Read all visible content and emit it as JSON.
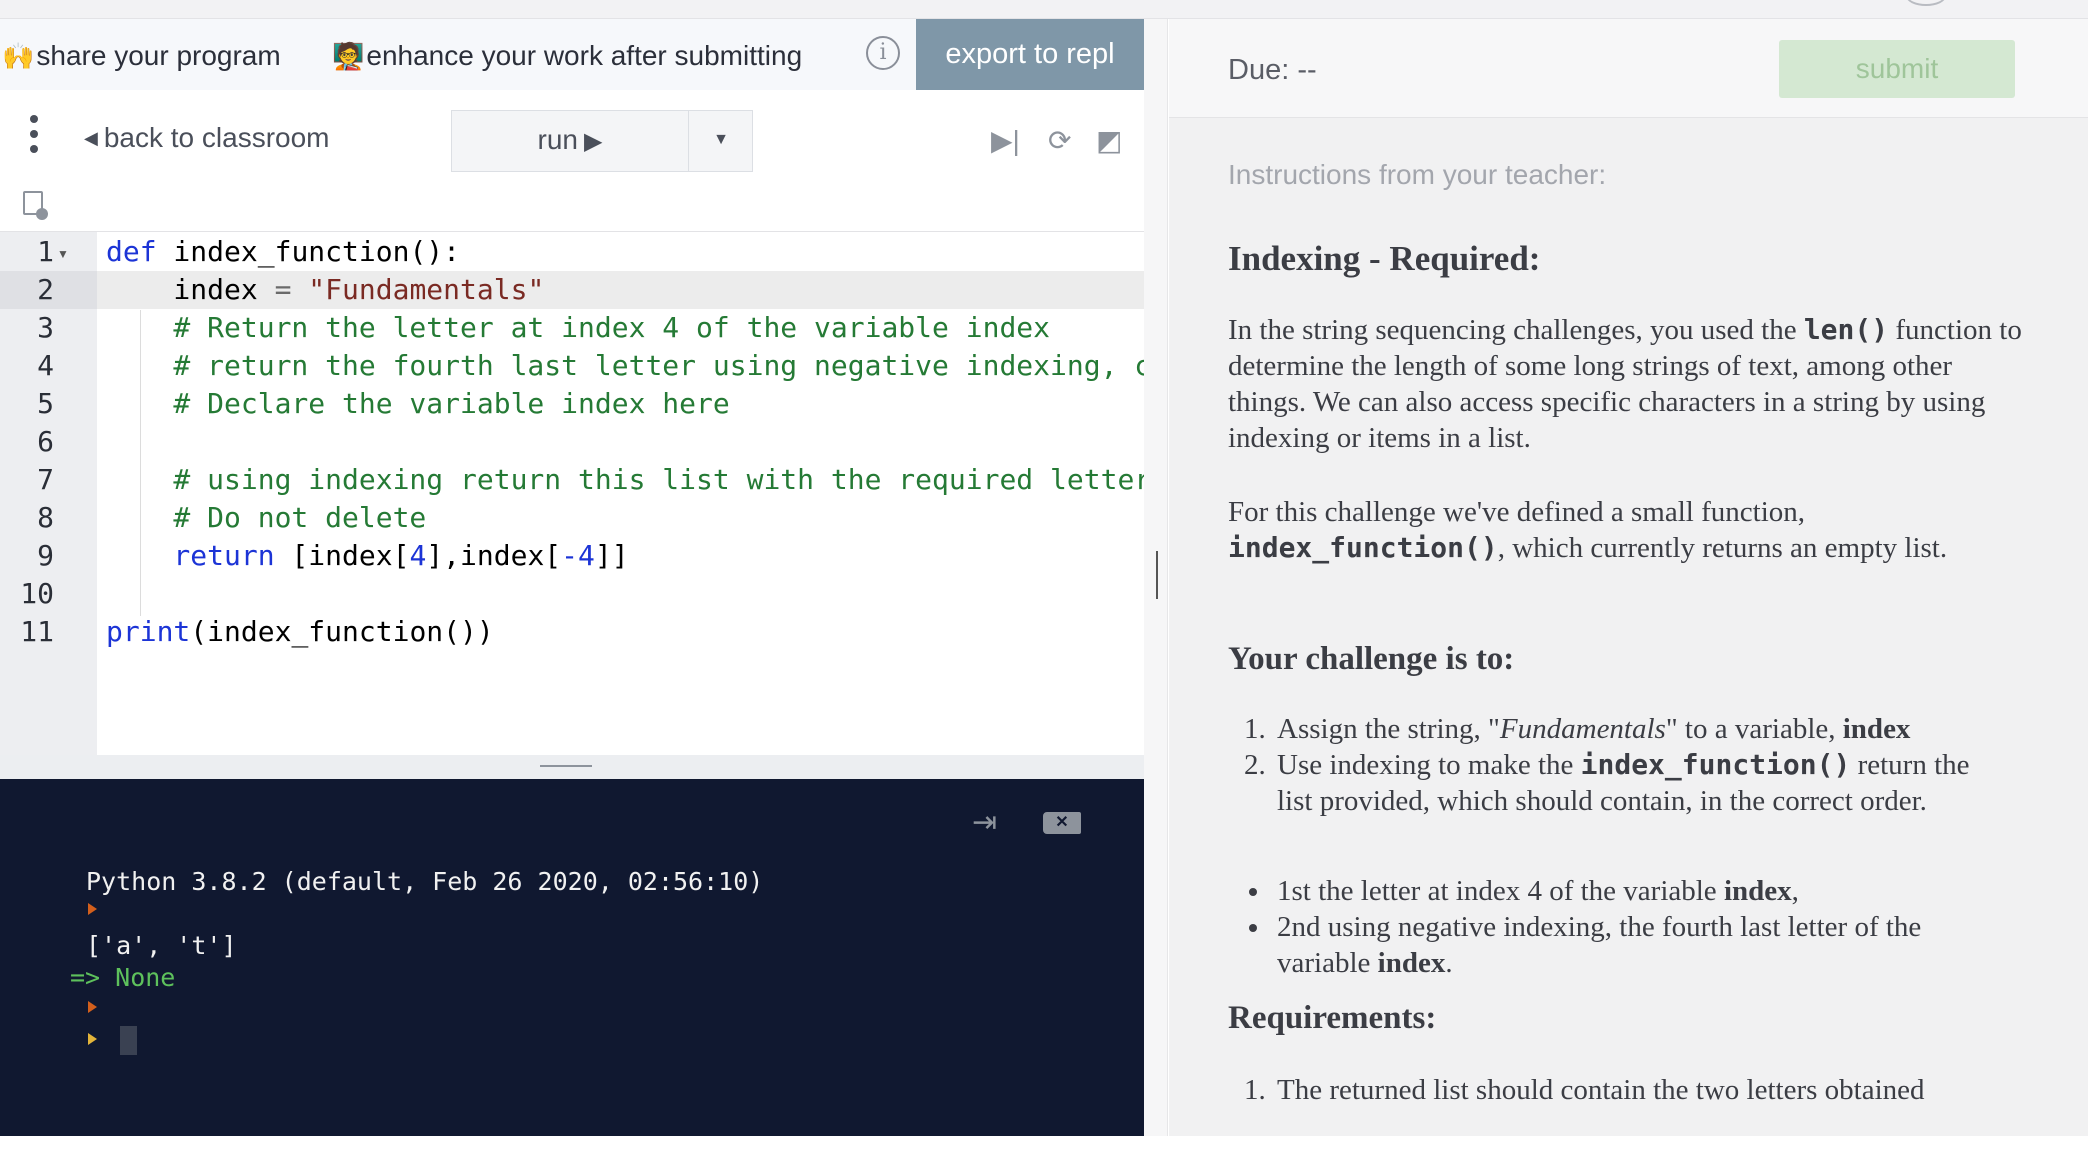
{
  "banner": {
    "share_label": "share your program",
    "enhance_label": "enhance your work after submitting",
    "export_label": "export to repl",
    "share_emoji": "🙌",
    "enhance_emoji": "🧑‍🏫"
  },
  "toolbar": {
    "back_label": "back to classroom",
    "run_label": "run"
  },
  "editor": {
    "line_numbers": [
      "1",
      "2",
      "3",
      "4",
      "5",
      "6",
      "7",
      "8",
      "9",
      "10",
      "11"
    ],
    "lines": [
      {
        "parts": [
          [
            "kw",
            "def"
          ],
          [
            "",
            " index_function():"
          ]
        ]
      },
      {
        "parts": [
          [
            "",
            "    index "
          ],
          [
            "op",
            "="
          ],
          [
            "str",
            " \"Fundamentals\""
          ]
        ]
      },
      {
        "parts": [
          [
            "cm",
            "    # Return the letter at index 4 of the variable index"
          ]
        ]
      },
      {
        "parts": [
          [
            "cm",
            "    # return the fourth last letter using negative indexing, c"
          ]
        ]
      },
      {
        "parts": [
          [
            "cm",
            "    # Declare the variable index here"
          ]
        ]
      },
      {
        "parts": [
          [
            "",
            ""
          ]
        ]
      },
      {
        "parts": [
          [
            "cm",
            "    # using indexing return this list with the required letter"
          ]
        ]
      },
      {
        "parts": [
          [
            "cm",
            "    # Do not delete"
          ]
        ]
      },
      {
        "parts": [
          [
            "kw",
            "    return"
          ],
          [
            "",
            " [index["
          ],
          [
            "num",
            "4"
          ],
          [
            "",
            "],index["
          ],
          [
            "num",
            "-4"
          ],
          [
            "",
            "]]"
          ]
        ]
      },
      {
        "parts": [
          [
            "",
            ""
          ]
        ]
      },
      {
        "parts": [
          [
            "kw",
            "print"
          ],
          [
            "",
            "(index_function())"
          ]
        ]
      }
    ]
  },
  "console": {
    "version_line": "Python 3.8.2 (default, Feb 26 2020, 02:56:10)",
    "output_line": "['a', 't']",
    "result_line": "=> None"
  },
  "assignment": {
    "due_label": "Due: --",
    "submit_label": "submit",
    "instructions_heading": "Instructions from your teacher:",
    "title": "Indexing - Required:",
    "p1_a": "In the string sequencing challenges, you used the ",
    "p1_code": "len()",
    "p1_b": " function to determine the length of some long strings of text, among other things. We can also access specific characters in a string by using indexing or items in a list.",
    "p2_a": "For this challenge we've defined a small function, ",
    "p2_code": "index_function()",
    "p2_b": ", which currently returns an empty list.",
    "challenge_heading": "Your challenge is to:",
    "steps": [
      {
        "num": "1.",
        "a": "Assign the string, \"",
        "em": "Fundamentals",
        "b": "\" to a variable, ",
        "strong": "index"
      },
      {
        "num": "2.",
        "a": "Use indexing to make the ",
        "code": "index_function()",
        "b": " return the list provided, which should contain, in the correct order."
      }
    ],
    "bullets": [
      {
        "a": "1st the letter at index 4 of the variable ",
        "strong": "index",
        "b": ","
      },
      {
        "a": "2nd using negative indexing, the fourth last letter of the variable ",
        "strong": "index",
        "b": "."
      }
    ],
    "requirements_heading": "Requirements:",
    "requirement_1_num": "1.",
    "requirement_1": "The returned list should contain the two letters obtained"
  }
}
